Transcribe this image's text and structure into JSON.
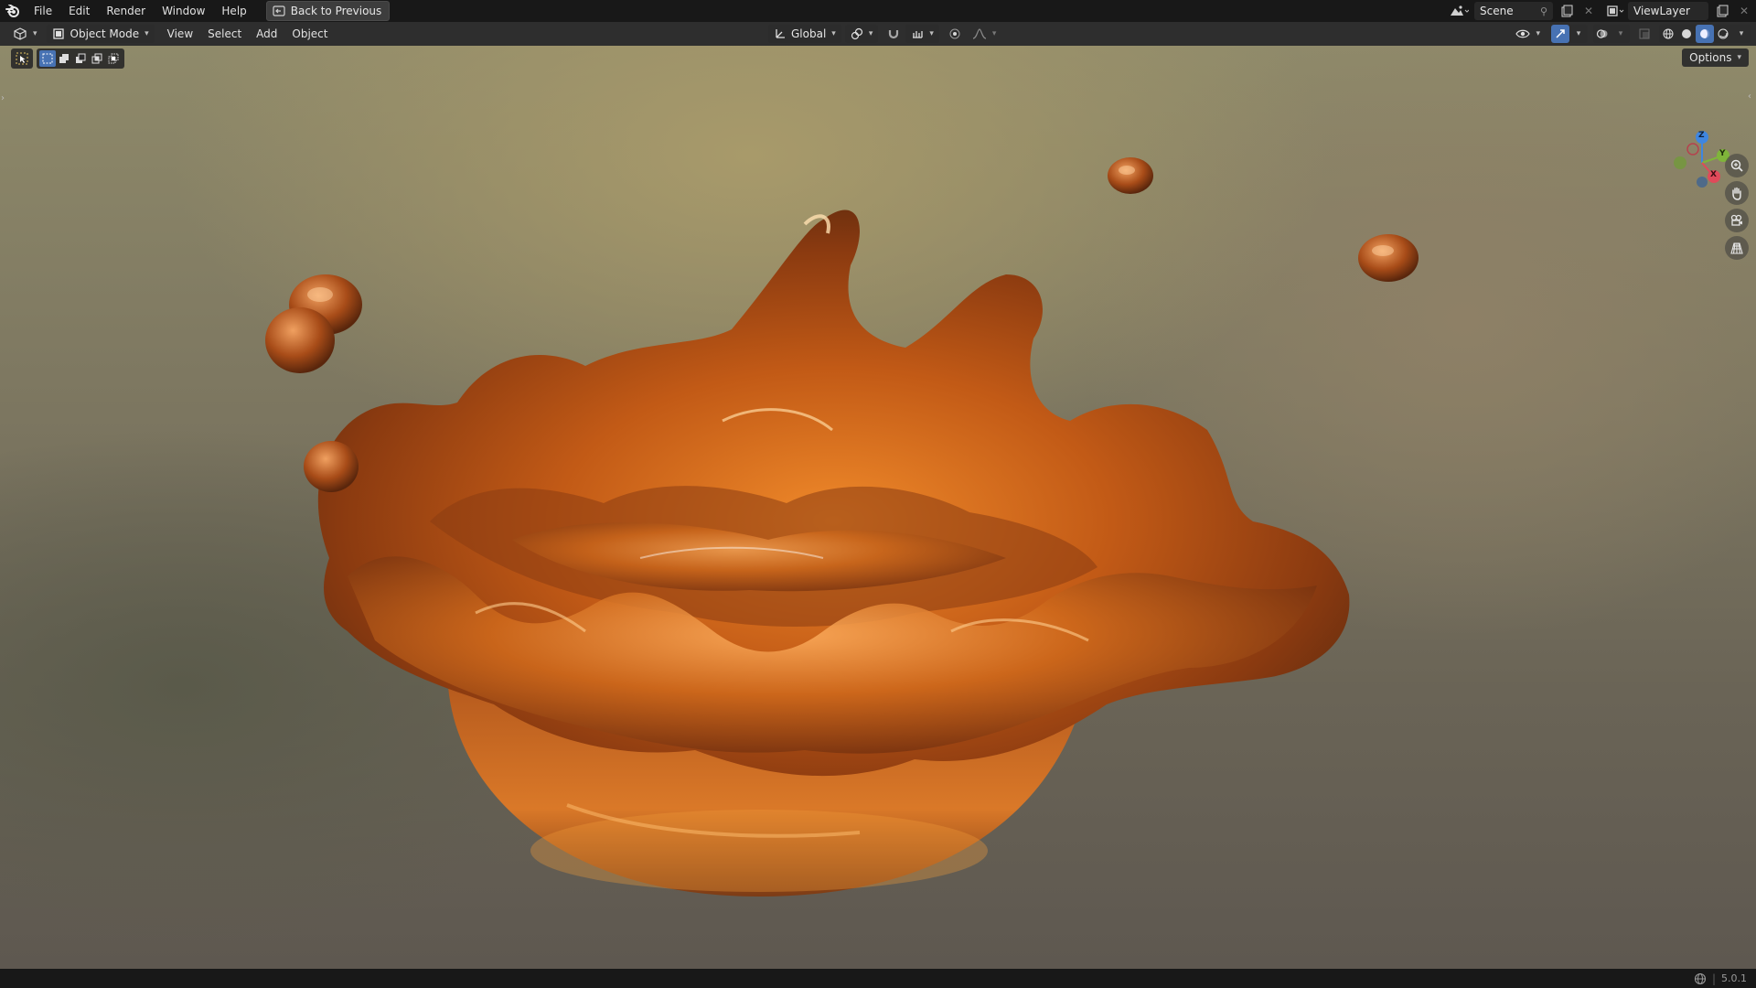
{
  "topbar": {
    "menu": [
      "File",
      "Edit",
      "Render",
      "Window",
      "Help"
    ],
    "back_button": "Back to Previous",
    "scene_name": "Scene",
    "view_layer_name": "ViewLayer"
  },
  "viewport_header": {
    "mode": "Object Mode",
    "menus": [
      "View",
      "Select",
      "Add",
      "Object"
    ],
    "transform_orientation": "Global",
    "options_label": "Options"
  },
  "gizmo": {
    "z_label": "Z",
    "y_label": "Y",
    "x_label": "X",
    "colors": {
      "x": "#e04a5a",
      "y": "#7fb53a",
      "z": "#3f86e0"
    }
  },
  "nav_buttons": [
    "zoom-icon",
    "hand-pan-icon",
    "camera-icon",
    "grid-icon"
  ],
  "statusbar": {
    "version": "5.0.1"
  },
  "scene": {
    "object": "liquid splash crown",
    "accent_color": "#4772b3",
    "liquid_color": "#c8621a"
  }
}
